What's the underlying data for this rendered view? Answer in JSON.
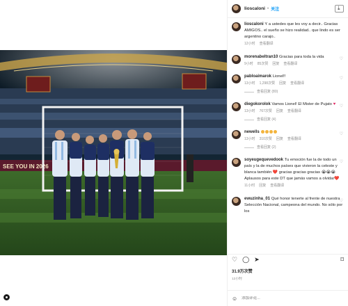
{
  "post": {
    "username": "lioscaloni",
    "follow_label": "关注",
    "dot": "•"
  },
  "caption": {
    "username": "lioscaloni",
    "text": "Y a ustedes que les voy a decir.. Gracias AMIGOS.. el sueño se hizo realidad.. que lindo es ser argentino carajo..",
    "time": "12小时",
    "translate": "查看翻译"
  },
  "comments": [
    {
      "username": "morenabeltran10",
      "text": "Gracias para toda la vida",
      "time": "9小时",
      "likes": "85次赞",
      "reply": "回复",
      "translate": "查看翻译"
    },
    {
      "username": "pabloaimarok",
      "text": "Lionel!!",
      "time": "13小时",
      "likes": "1,298次赞",
      "reply": "回复",
      "translate": "查看翻译",
      "replies_label": "查看回复 (80)"
    },
    {
      "username": "diegokorolok",
      "text": "Vamos Lionel! El Mister de Pujato",
      "time": "13小时",
      "likes": "767次赞",
      "reply": "回复",
      "translate": "查看翻译",
      "replies_label": "查看回复 (4)"
    },
    {
      "username": "newells",
      "text": "",
      "time": "13小时",
      "likes": "310次赞",
      "reply": "回复",
      "translate": "查看翻译",
      "replies_label": "查看回复 (2)"
    },
    {
      "username": "soyeugequevedook",
      "text": "Tu emoción fue la de todo un país y la de muchos países que vivieron la celeste y blanca también ❤️ gracias gracias gracias 😭😭😭 Aplausos para este DT que jamás vamos a olvidar❤️",
      "time": "11小时",
      "likes": "",
      "reply": "回复",
      "translate": "查看翻译"
    },
    {
      "username": "ewuzinha_01",
      "text": "Qué honor tenerte al frente de nuestra Selección Nacional, campeona del mundo. No sólo por los",
      "time": "",
      "likes": "",
      "reply": "",
      "translate": ""
    }
  ],
  "actions": {
    "like_icon": "heart-icon",
    "comment_icon": "comment-icon",
    "share_icon": "share-icon",
    "save_icon": "bookmark-icon"
  },
  "likes_count": "31.9万次赞",
  "posted_time": "12小时",
  "add_comment": {
    "placeholder": "添加评论..."
  },
  "photo": {
    "banner_text": "SEE YOU IN 2026"
  },
  "colors": {
    "accent": "#0095f6",
    "heart": "#e0245e",
    "muted": "#8e8e8e"
  }
}
